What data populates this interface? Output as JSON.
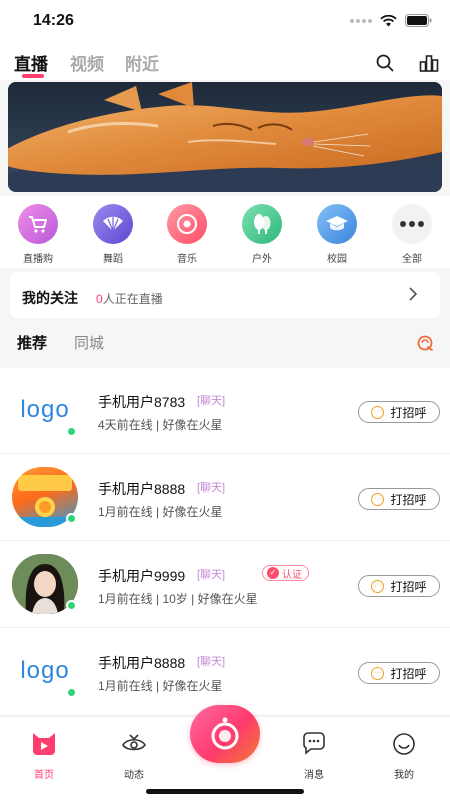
{
  "status_bar": {
    "time": "14:26"
  },
  "top_nav": {
    "tabs": [
      {
        "label": "直播",
        "active": true
      },
      {
        "label": "视频",
        "active": false
      },
      {
        "label": "附近",
        "active": false
      }
    ],
    "icons": [
      "search-icon",
      "ranking-icon"
    ]
  },
  "banner": {
    "alt": "cat-photo"
  },
  "categories": [
    {
      "label": "直播购",
      "icon": "cart-icon",
      "color": "#d36bd6"
    },
    {
      "label": "舞蹈",
      "icon": "fan-icon",
      "color": "#7a5fe0"
    },
    {
      "label": "音乐",
      "icon": "music-icon",
      "color": "#ff5a6e"
    },
    {
      "label": "户外",
      "icon": "tree-icon",
      "color": "#3bc48a"
    },
    {
      "label": "校园",
      "icon": "graduation-cap-icon",
      "color": "#4a9be8"
    },
    {
      "label": "全部",
      "icon": "more-dots-icon",
      "color": "#555555"
    }
  ],
  "follow": {
    "title": "我的关注",
    "count": "0",
    "suffix": "人正在直播"
  },
  "sub_tabs": [
    {
      "label": "推荐",
      "active": true
    },
    {
      "label": "同城",
      "active": false
    }
  ],
  "feed": [
    {
      "name": "手机用户8783",
      "tag": "[聊天]",
      "meta": "4天前在线 | 好像在火星",
      "avatar": "logo",
      "avatar_text": "logo",
      "certified": false,
      "button": "打招呼"
    },
    {
      "name": "手机用户8888",
      "tag": "[聊天]",
      "meta": "1月前在线 | 好像在火星",
      "avatar": "promo",
      "certified": false,
      "button": "打招呼"
    },
    {
      "name": "手机用户9999",
      "tag": "[聊天]",
      "meta": "1月前在线 | 10岁 | 好像在火星",
      "avatar": "photo",
      "certified": true,
      "cert_label": "认证",
      "button": "打招呼"
    },
    {
      "name": "手机用户8888",
      "tag": "[聊天]",
      "meta": "1月前在线 | 好像在火星",
      "avatar": "logo",
      "avatar_text": "logo",
      "certified": false,
      "button": "打招呼"
    }
  ],
  "bottom_nav": [
    {
      "label": "首页",
      "icon": "home-icon",
      "active": true
    },
    {
      "label": "动态",
      "icon": "eye-icon",
      "active": false
    },
    {
      "label": "消息",
      "icon": "chat-icon",
      "active": false
    },
    {
      "label": "我的",
      "icon": "profile-icon",
      "active": false
    }
  ],
  "colors": {
    "accent": "#ff3d6e",
    "online": "#2fd37a",
    "tag": "#c586d8"
  }
}
